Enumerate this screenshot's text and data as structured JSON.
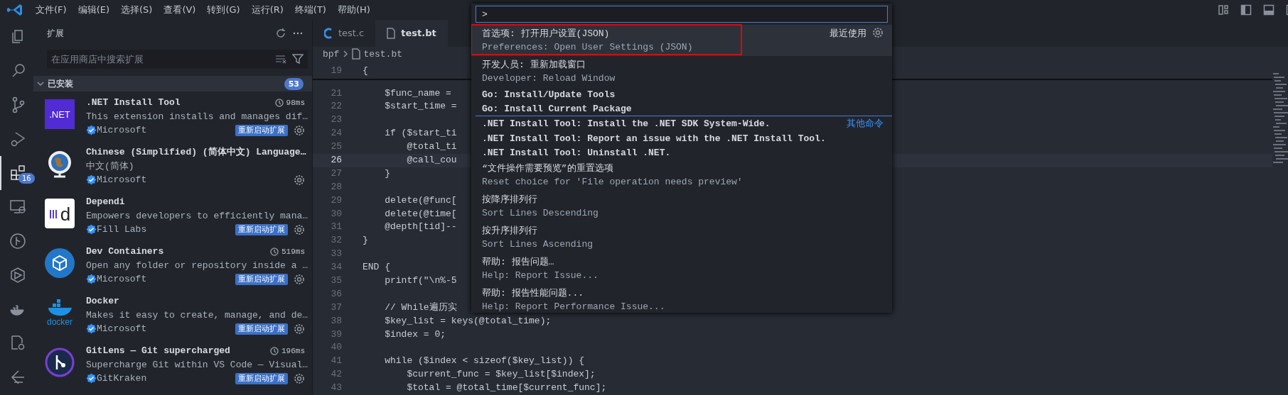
{
  "menu": [
    "文件(F)",
    "编辑(E)",
    "选择(S)",
    "查看(V)",
    "转到(G)",
    "运行(R)",
    "终端(T)",
    "帮助(H)"
  ],
  "activity_bar": [
    {
      "kind": "files",
      "selected": false
    },
    {
      "kind": "search",
      "selected": false
    },
    {
      "kind": "branch",
      "selected": false
    },
    {
      "kind": "debug",
      "selected": false
    },
    {
      "kind": "extensions",
      "selected": true,
      "badge": "16"
    },
    {
      "kind": "remote",
      "selected": false
    },
    {
      "kind": "graph",
      "selected": false
    },
    {
      "kind": "cube",
      "selected": false
    },
    {
      "kind": "docker",
      "selected": false
    },
    {
      "kind": "gear-doc",
      "selected": false
    },
    {
      "kind": "arrow",
      "selected": false
    }
  ],
  "sidebar": {
    "title": "扩展",
    "search": {
      "placeholder": "在应用商店中搜索扩展"
    },
    "section": {
      "title": "已安装",
      "expanded": true,
      "count": "53"
    },
    "extensions": [
      {
        "name": ".NET Install Tool",
        "description": "This extension installs and manages dif…",
        "publisher": "Microsoft",
        "verified": true,
        "kind": "net",
        "logo_text": ".NET",
        "time": "98ms",
        "action": "重新启动扩展"
      },
      {
        "name": "Chinese (Simplified) (简体中文) Language…",
        "description": "中文(简体)",
        "publisher": "Microsoft",
        "verified": true,
        "kind": "globe"
      },
      {
        "name": "Dependi",
        "description": "Empowers developers to efficiently mana…",
        "publisher": "Fill Labs",
        "verified": true,
        "kind": "dependi",
        "logo_text": "d",
        "action": "重新启动扩展"
      },
      {
        "name": "Dev Containers",
        "description": "Open any folder or repository inside a …",
        "publisher": "Microsoft",
        "verified": true,
        "kind": "box",
        "time": "519ms",
        "action": "重新启动扩展"
      },
      {
        "name": "Docker",
        "description": "Makes it easy to create, manage, and de…",
        "publisher": "Microsoft",
        "verified": true,
        "kind": "docker",
        "logo_text": "docker",
        "action": "重新启动扩展"
      },
      {
        "name": "GitLens — Git supercharged",
        "description": "Supercharge Git within VS Code — Visual…",
        "publisher": "GitKraken",
        "verified": true,
        "kind": "gitlens",
        "time": "196ms",
        "action": "重新启动扩展"
      }
    ]
  },
  "editor": {
    "tabs": [
      {
        "label": "test.c",
        "kind": "c",
        "selected": false
      },
      {
        "label": "test.bt",
        "kind": "file",
        "selected": true
      }
    ],
    "breadcrumb": [
      "bpf",
      "test.bt"
    ],
    "lines": [
      {
        "number": "19",
        "text": "{",
        "current": false
      },
      {
        "number": "21",
        "text": "    $func_name = ",
        "current": false
      },
      {
        "number": "22",
        "text": "    $start_time =",
        "current": false
      },
      {
        "number": "23",
        "current": false
      },
      {
        "number": "24",
        "text": "    if ($start_ti",
        "current": false
      },
      {
        "number": "25",
        "text": "        @total_ti",
        "current": false
      },
      {
        "number": "26",
        "text": "        @call_cou",
        "current": true
      },
      {
        "number": "27",
        "text": "    }",
        "current": false
      },
      {
        "number": "28",
        "current": false
      },
      {
        "number": "29",
        "text": "    delete(@func[",
        "current": false
      },
      {
        "number": "30",
        "text": "    delete(@time[",
        "current": false
      },
      {
        "number": "31",
        "text": "    @depth[tid]--",
        "current": false
      },
      {
        "number": "32",
        "text": "}",
        "current": false
      },
      {
        "number": "33",
        "current": false
      },
      {
        "number": "34",
        "text": "END {",
        "current": false
      },
      {
        "number": "35",
        "text": "    printf(\"\\n%-5",
        "current": false
      },
      {
        "number": "36",
        "current": false
      },
      {
        "number": "37",
        "text": "    // While遍历实",
        "current": false
      },
      {
        "number": "38",
        "text": "    $key_list = keys(@total_time);",
        "current": false
      },
      {
        "number": "39",
        "text": "    $index = 0;",
        "current": false
      },
      {
        "number": "40",
        "current": false
      },
      {
        "number": "41",
        "text": "    while ($index < sizeof($key_list)) {",
        "current": false
      },
      {
        "number": "42",
        "text": "        $current_func = $key_list[$index];",
        "current": false
      },
      {
        "number": "43",
        "text": "        $total = @total_time[$current_func];",
        "current": false
      }
    ]
  },
  "command_palette": {
    "input": {
      "value": ">"
    },
    "items": [
      {
        "kind": "double",
        "label": "首选项: 打开用户设置(JSON)",
        "detail": "Preferences: Open User Settings (JSON)",
        "selected": true,
        "outlined": true,
        "group_label": "最近使用"
      },
      {
        "kind": "double",
        "label": "开发人员: 重新加载窗口",
        "detail": "Developer: Reload Window",
        "selected": false,
        "outlined": false
      },
      {
        "kind": "single",
        "label": "Go: Install/Update Tools",
        "selected": false,
        "outlined": false
      },
      {
        "kind": "single",
        "label": "Go: Install Current Package",
        "selected": false,
        "outlined": false
      },
      {
        "kind": "single",
        "label": ".NET Install Tool: Install the .NET SDK System-Wide.",
        "selected": false,
        "outlined": false,
        "group_label": "其他命令"
      },
      {
        "kind": "single",
        "label": ".NET Install Tool: Report an issue with the .NET Install Tool.",
        "selected": false,
        "outlined": false
      },
      {
        "kind": "single",
        "label": ".NET Install Tool: Uninstall .NET.",
        "selected": false,
        "outlined": false
      },
      {
        "kind": "double",
        "label": "“文件操作需要预览”的重置选项",
        "detail": "Reset choice for 'File operation needs preview'",
        "selected": false,
        "outlined": false
      },
      {
        "kind": "double",
        "label": "按降序排列行",
        "detail": "Sort Lines Descending",
        "selected": false,
        "outlined": false
      },
      {
        "kind": "double",
        "label": "按升序排列行",
        "detail": "Sort Lines Ascending",
        "selected": false,
        "outlined": false
      },
      {
        "kind": "double",
        "label": "帮助: 报告问题…",
        "detail": "Help: Report Issue...",
        "selected": false,
        "outlined": false
      },
      {
        "kind": "double",
        "label": "帮助: 报告性能问题...",
        "detail": "Help: Report Performance Issue...",
        "selected": false,
        "outlined": false
      }
    ]
  }
}
